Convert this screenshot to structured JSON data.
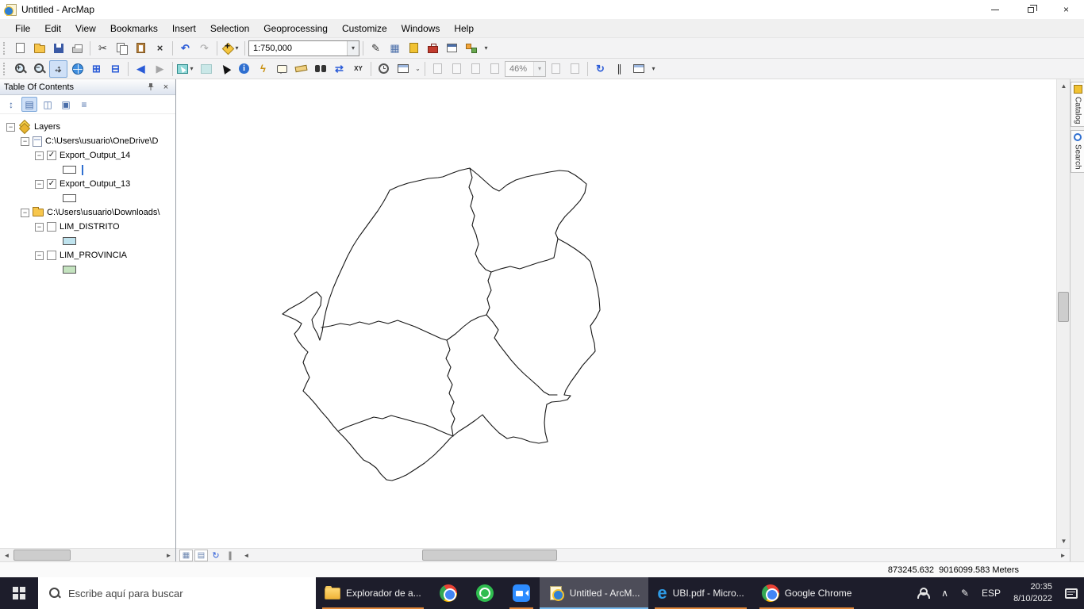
{
  "window": {
    "title": "Untitled - ArcMap"
  },
  "menubar": {
    "items": [
      "File",
      "Edit",
      "View",
      "Bookmarks",
      "Insert",
      "Selection",
      "Geoprocessing",
      "Customize",
      "Windows",
      "Help"
    ]
  },
  "standard_toolbar": {
    "scale": "1:750,000"
  },
  "tools_toolbar": {
    "zoom": "46%"
  },
  "toc": {
    "title": "Table Of Contents",
    "nodes": {
      "layers": "Layers",
      "group1": "C:\\Users\\usuario\\OneDrive\\D",
      "layer1": "Export_Output_14",
      "layer2": "Export_Output_13",
      "group2": "C:\\Users\\usuario\\Downloads\\",
      "layer3": "LIM_DISTRITO",
      "layer4": "LIM_PROVINCIA"
    }
  },
  "side_tabs": {
    "catalog": "Catalog",
    "search": "Search"
  },
  "statusbar": {
    "coordinates": "873245.632  9016099.583 Meters"
  },
  "taskbar": {
    "search_placeholder": "Escribe aquí para buscar",
    "apps": {
      "explorer": "Explorador de a...",
      "arcmap": "Untitled - ArcM...",
      "edge": "UBI.pdf - Micro...",
      "chrome": "Google Chrome"
    },
    "tray": {
      "language": "ESP",
      "time": "20:35",
      "date": "8/10/2022"
    }
  },
  "icons": {
    "close": "×",
    "check": "✓",
    "expander": "−",
    "cut": "✂",
    "delete": "×",
    "undo": "↶",
    "redo": "↷",
    "back": "◀",
    "forward": "▶",
    "dropdown": "▾",
    "overflow": "⌄",
    "fixed_zoom_in": "⊞",
    "fixed_zoom_out": "⊟",
    "pencil": "✎",
    "table": "▦",
    "lightning": "ϟ",
    "route": "⇄",
    "xy": "XY",
    "refresh": "↻",
    "pause": "∥",
    "up": "▲",
    "down": "▼",
    "left": "◄",
    "right": "►",
    "data_view": "▦",
    "layout_view": "▤",
    "toc_order": "↕",
    "toc_source": "▤",
    "toc_visibility": "◫",
    "toc_selection": "▣",
    "toc_options": "≡",
    "chevron_up": "∧",
    "pen": "✎",
    "edge_letter": "e",
    "info": "i",
    "mag_plus": "+",
    "mag_minus": "−"
  }
}
